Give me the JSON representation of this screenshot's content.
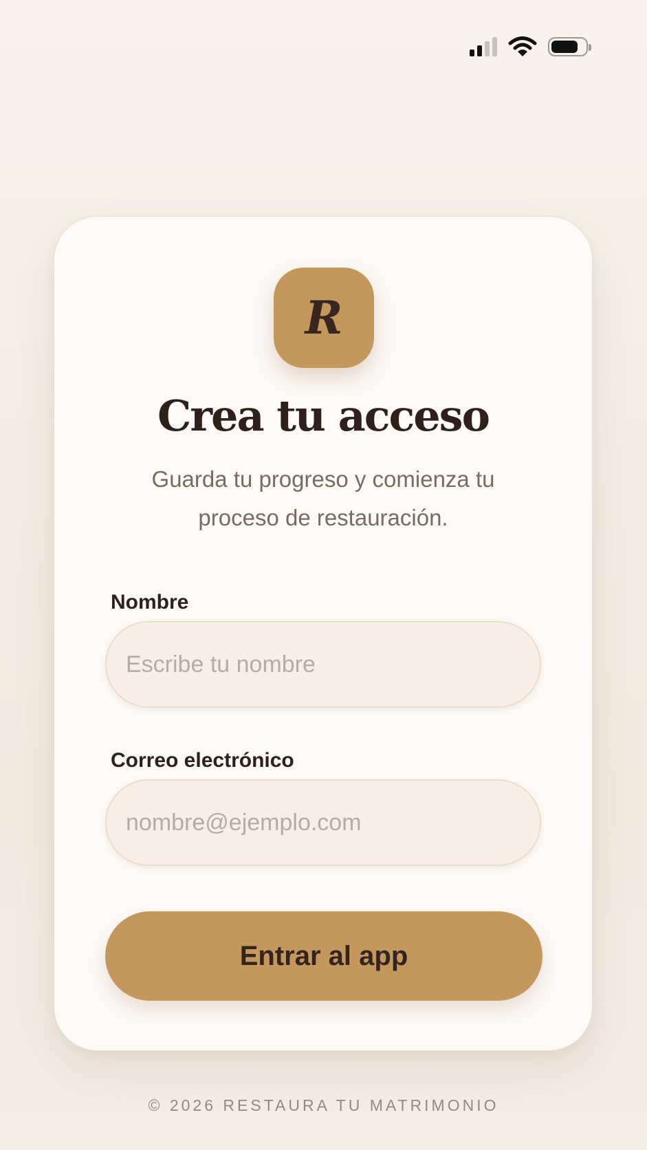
{
  "status_bar": {
    "signal_icon": "cellular-signal-icon",
    "signal_bars_active": 2,
    "signal_bars_total": 4,
    "wifi_icon": "wifi-icon",
    "battery_icon": "battery-icon",
    "battery_level": 0.8
  },
  "brand": {
    "logo_letter": "R",
    "accent_color": "#c4985d",
    "text_color": "#2f201b"
  },
  "form": {
    "title": "Crea tu acceso",
    "subtitle": "Guarda tu progreso y comienza tu proceso de restauración.",
    "name": {
      "label": "Nombre",
      "placeholder": "Escribe tu nombre",
      "value": ""
    },
    "email": {
      "label": "Correo electrónico",
      "placeholder": "nombre@ejemplo.com",
      "value": ""
    },
    "submit_label": "Entrar al app"
  },
  "footer": {
    "text": "© 2026 RESTAURA TU MATRIMONIO"
  }
}
